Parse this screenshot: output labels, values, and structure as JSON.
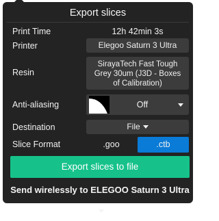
{
  "title": "Export slices",
  "rows": {
    "print_time": {
      "label": "Print Time",
      "value": "12h 42min 3s"
    },
    "printer": {
      "label": "Printer",
      "value": "Elegoo Saturn 3 Ultra"
    },
    "resin": {
      "label": "Resin",
      "value": "SirayaTech Fast Tough Grey 30um   (J3D - Boxes of Calibration)"
    },
    "anti_aliasing": {
      "label": "Anti-aliasing",
      "value": "Off",
      "icon": "anti-aliasing-preview-icon"
    },
    "destination": {
      "label": "Destination",
      "value": "File"
    },
    "slice_format": {
      "label": "Slice Format",
      "options": [
        ".goo",
        ".ctb"
      ],
      "selected": ".ctb"
    }
  },
  "actions": {
    "export": "Export slices to file",
    "send": "Send wirelessly to ELEGOO Saturn 3 Ultra"
  },
  "colors": {
    "panel": "#232323",
    "control": "#3c3c3c",
    "accent_blue": "#0a7bd7",
    "accent_green": "#16c28a"
  }
}
